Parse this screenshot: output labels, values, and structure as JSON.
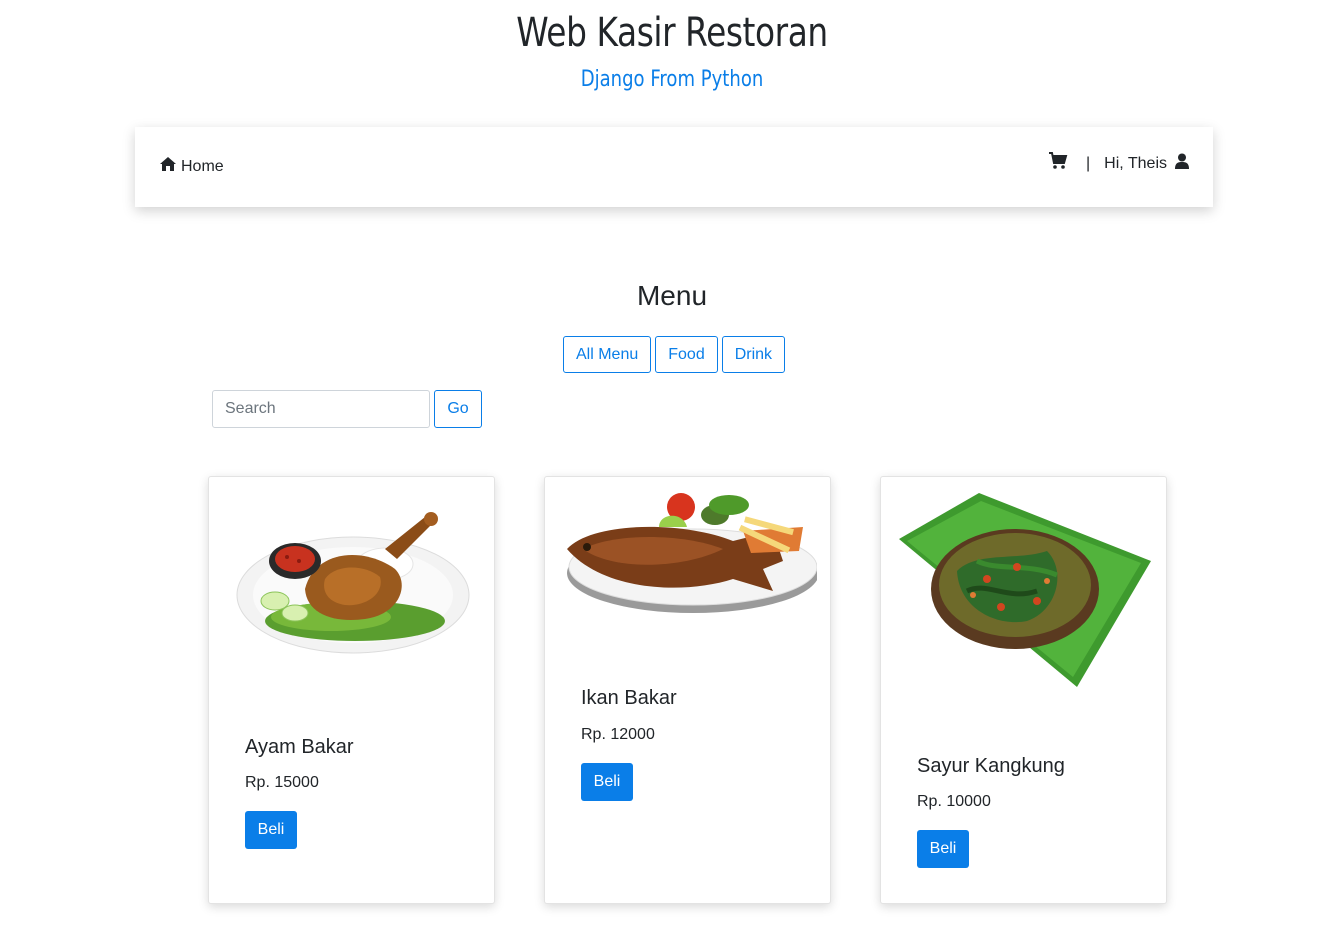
{
  "header": {
    "title": "Web Kasir Restoran",
    "subtitle": "Django From Python"
  },
  "navbar": {
    "home_label": "Home",
    "separator": "|",
    "greeting": "Hi, Theis"
  },
  "menu": {
    "heading": "Menu",
    "filters": [
      "All Menu",
      "Food",
      "Drink"
    ],
    "search_placeholder": "Search",
    "go_label": "Go"
  },
  "items": [
    {
      "name": "Ayam Bakar",
      "price": "Rp. 15000",
      "button": "Beli"
    },
    {
      "name": "Ikan Bakar",
      "price": "Rp. 12000",
      "button": "Beli"
    },
    {
      "name": "Sayur Kangkung",
      "price": "Rp. 10000",
      "button": "Beli"
    }
  ],
  "colors": {
    "primary": "#0a7ee8",
    "text": "#212529"
  }
}
